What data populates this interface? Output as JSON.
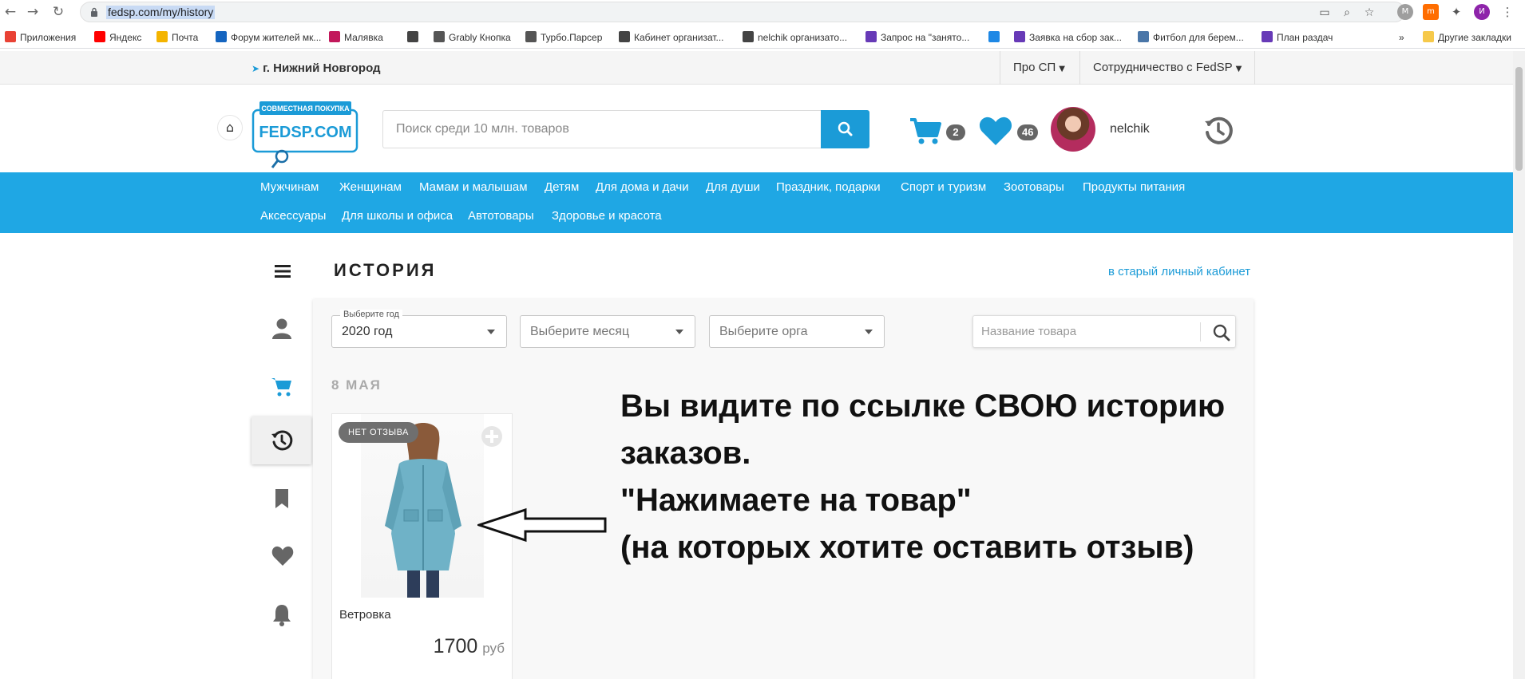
{
  "browser": {
    "url": "fedsp.com/my/history",
    "bookmarks": [
      {
        "label": "Приложения",
        "icon": "apps-grid-icon",
        "color": "#e94235"
      },
      {
        "label": "Яндекс",
        "icon": "yandex-icon",
        "color": "#ff0000"
      },
      {
        "label": "Почта",
        "icon": "mail-icon",
        "color": "#f4b400"
      },
      {
        "label": "Форум жителей мк...",
        "icon": "forum-icon",
        "color": "#1565c0"
      },
      {
        "label": "Малявка",
        "icon": "malyavka-icon",
        "color": "#c2185b"
      },
      {
        "label": "",
        "icon": "cart-bookmark-icon",
        "color": "#444444"
      },
      {
        "label": "Grably Кнопка",
        "icon": "globe-icon",
        "color": "#555555"
      },
      {
        "label": "Турбо.Парсер",
        "icon": "globe-icon",
        "color": "#555555"
      },
      {
        "label": "Кабинет организат...",
        "icon": "cart-bookmark-icon",
        "color": "#444444"
      },
      {
        "label": "nelchik организато...",
        "icon": "cart-bookmark-icon",
        "color": "#444444"
      },
      {
        "label": "Запрос на \"занято...",
        "icon": "form-icon",
        "color": "#673ab7"
      },
      {
        "label": "",
        "icon": "tool-icon",
        "color": "#1e88e5"
      },
      {
        "label": "Заявка на сбор зак...",
        "icon": "form-icon",
        "color": "#673ab7"
      },
      {
        "label": "Фитбол для берем...",
        "icon": "vk-icon",
        "color": "#4a76a8"
      },
      {
        "label": "План раздач",
        "icon": "form-icon",
        "color": "#673ab7"
      }
    ],
    "more_label": "»",
    "other_bookmarks": "Другие закладки",
    "profile_initial": "И"
  },
  "topbar": {
    "city": "г. Нижний Новгород",
    "menu": [
      "Про СП",
      "Сотрудничество с FedSP"
    ]
  },
  "header": {
    "logo_top": "СОВМЕСТНАЯ ПОКУПКА",
    "logo_main": "FEDSP.COM",
    "search_placeholder": "Поиск среди 10 млн. товаров",
    "cart_count": "2",
    "favorites_count": "46",
    "username": "nelchik"
  },
  "categories": {
    "row1": [
      "Мужчинам",
      "Женщинам",
      "Мамам и малышам",
      "Детям",
      "Для дома и дачи",
      "Для души",
      "Праздник, подарки",
      "Спорт и туризм",
      "Зоотовары",
      "Продукты питания"
    ],
    "row2": [
      "Аксессуары",
      "Для школы и офиса",
      "Автотовары",
      "Здоровье и красота"
    ]
  },
  "page": {
    "title": "ИСТОРИЯ",
    "old_cabinet_link": "в старый личный кабинет",
    "filters": {
      "year_label": "Выберите год",
      "year_value": "2020 год",
      "month_placeholder": "Выберите месяц",
      "org_placeholder": "Выберите орга",
      "name_placeholder": "Название товара"
    },
    "date_heading": "8 МАЯ",
    "product": {
      "badge": "НЕТ ОТЗЫВА",
      "title": "Ветровка",
      "price": "1700",
      "currency": "руб"
    }
  },
  "annotation": {
    "lines": [
      "Вы видите по ссылке СВОЮ историю",
      "заказов.",
      "\"Нажимаете на товар\"",
      "(на которых хотите оставить отзыв)"
    ]
  },
  "colors": {
    "brand_blue": "#1fa7e4",
    "accent_blue": "#1b9bd7"
  }
}
